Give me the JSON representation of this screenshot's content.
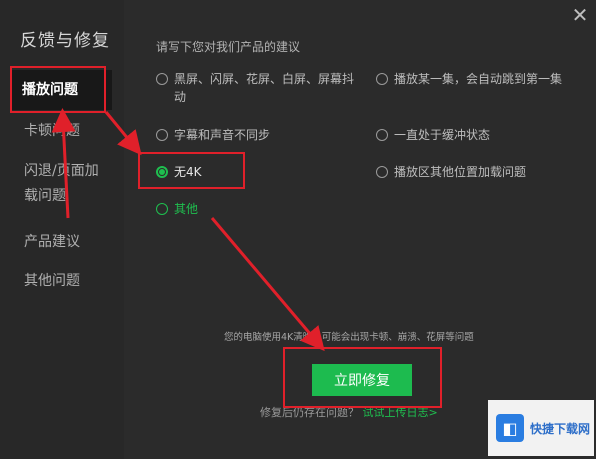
{
  "dialog": {
    "title": "反馈与修复",
    "close_glyph": "✕"
  },
  "sidebar": {
    "items": [
      {
        "label": "播放问题",
        "active": true
      },
      {
        "label": "卡顿问题"
      },
      {
        "label": "闪退/页面加载问题"
      },
      {
        "label": "产品建议"
      },
      {
        "label": "其他问题"
      }
    ]
  },
  "main": {
    "prompt": "请写下您对我们产品的建议",
    "options": [
      {
        "label": "黑屏、闪屏、花屏、白屏、屏幕抖动",
        "checked": false
      },
      {
        "label": "播放某一集，会自动跳到第一集",
        "checked": false
      },
      {
        "label": "字幕和声音不同步",
        "checked": false
      },
      {
        "label": "一直处于缓冲状态",
        "checked": false
      },
      {
        "label": "无4K",
        "checked": true
      },
      {
        "label": "播放区其他位置加载问题",
        "checked": false
      },
      {
        "label": "其他",
        "checked": false
      }
    ],
    "notice": "您的电脑使用4K清晰，可能会出现卡顿、崩溃、花屏等问题",
    "fix_button": "立即修复",
    "footer_text": "修复后仍存在问题？",
    "footer_link": "试试上传日志>"
  },
  "watermark": {
    "text": "快捷下载网",
    "logo_glyph": "◧"
  },
  "colors": {
    "accent_green": "#1dbb4f",
    "highlight_red": "#e0202a",
    "background": "#2b2b2b"
  }
}
